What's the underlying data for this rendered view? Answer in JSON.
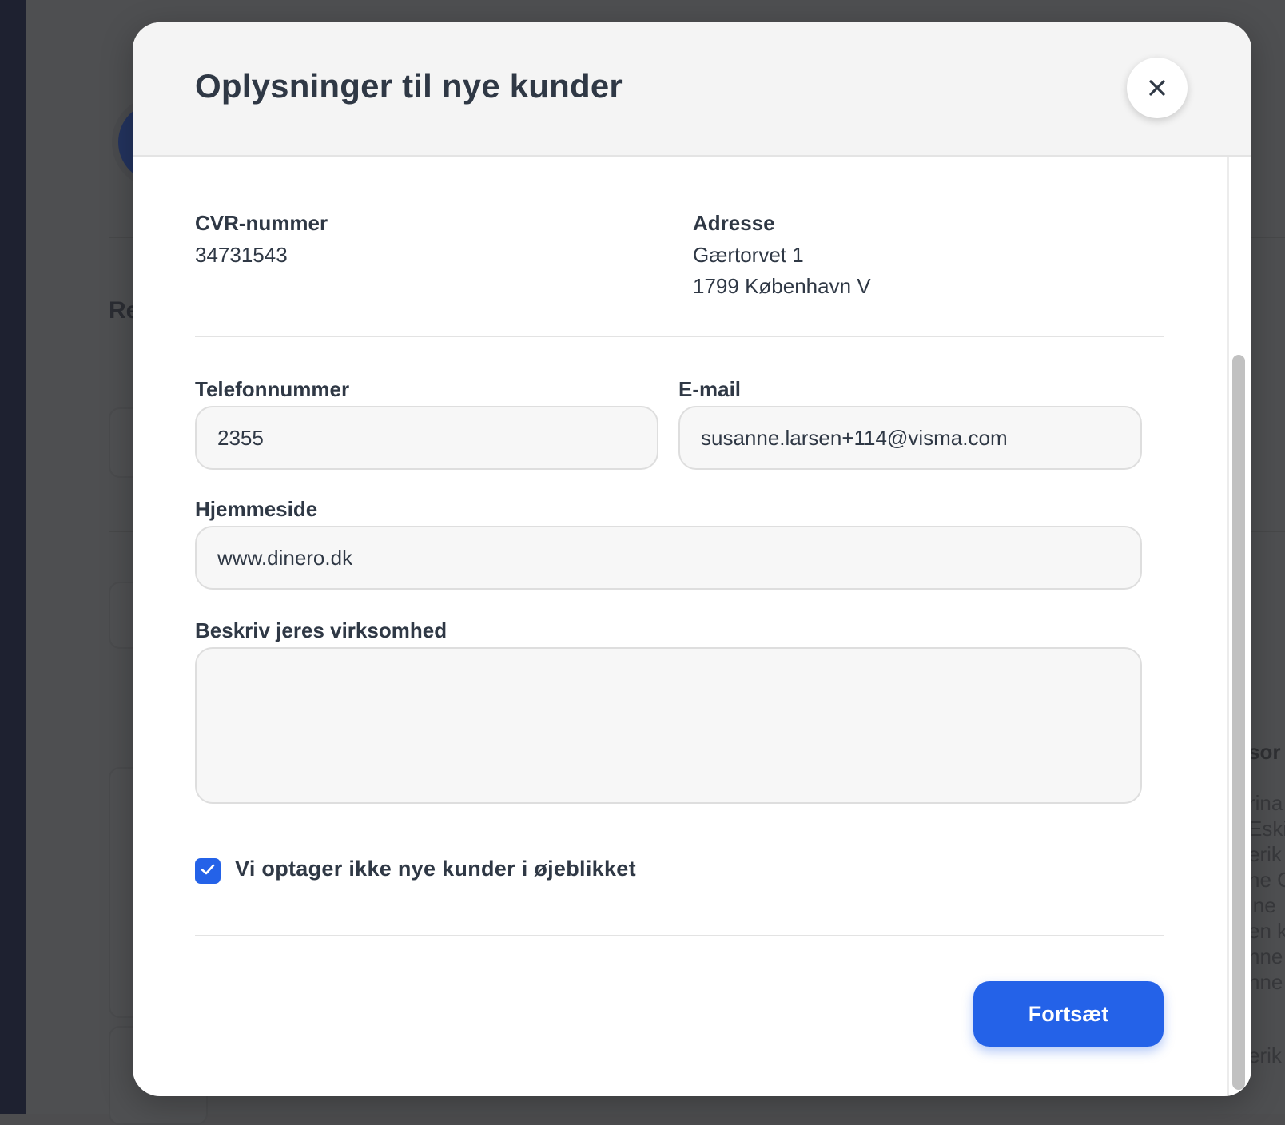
{
  "background": {
    "heading_fragment": "Re",
    "right_heading_fragment": "sor",
    "right_text_fragments": [
      "rina",
      "Eski",
      "erik",
      "ne C",
      "ine",
      "en k",
      "nne",
      "nne",
      "erik"
    ]
  },
  "modal": {
    "title": "Oplysninger til nye kunder",
    "close_icon": "close-icon",
    "cvr": {
      "label": "CVR-nummer",
      "value": "34731543"
    },
    "address": {
      "label": "Adresse",
      "line1": "Gærtorvet 1",
      "line2": "1799 København V"
    },
    "phone": {
      "label": "Telefonnummer",
      "value": "2355"
    },
    "email": {
      "label": "E-mail",
      "value": "susanne.larsen+114@visma.com"
    },
    "website": {
      "label": "Hjemmeside",
      "value": "www.dinero.dk"
    },
    "description": {
      "label": "Beskriv jeres virksomhed",
      "value": ""
    },
    "not_accepting": {
      "label": "Vi optager ikke nye kunder i øjeblikket",
      "checked": true
    },
    "continue_label": "Fortsæt"
  },
  "colors": {
    "accent": "#2462e8",
    "text": "#2f3845",
    "overlay": "#4d4d4f"
  }
}
